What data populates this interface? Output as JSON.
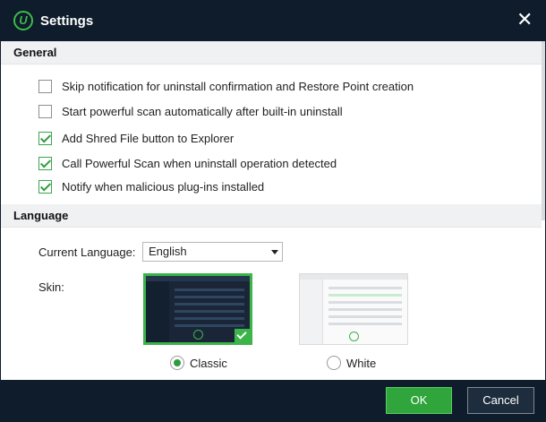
{
  "window": {
    "title": "Settings",
    "logo_glyph": "U"
  },
  "general": {
    "header": "General",
    "options": [
      {
        "label": "Skip notification for uninstall confirmation and Restore Point creation",
        "checked": false
      },
      {
        "label": "Start powerful scan automatically after built-in uninstall",
        "checked": false
      },
      {
        "label": "Add Shred File button to Explorer",
        "checked": true
      },
      {
        "label": "Call Powerful Scan when uninstall operation detected",
        "checked": true
      },
      {
        "label": "Notify when malicious plug-ins installed",
        "checked": true
      }
    ]
  },
  "language": {
    "header": "Language",
    "current_label": "Current Language:",
    "current_value": "English",
    "skin_label": "Skin:",
    "skins": [
      {
        "label": "Classic",
        "selected": true
      },
      {
        "label": "White",
        "selected": false
      }
    ]
  },
  "footer": {
    "ok_label": "OK",
    "cancel_label": "Cancel"
  },
  "colors": {
    "titlebar": "#0e1c2b",
    "accent": "#2fa53b",
    "check": "#2e9c3d"
  },
  "icons": {
    "logo": "app-logo-icon",
    "close": "close-icon",
    "dropdown": "chevron-down-icon",
    "selected": "checkmark-icon"
  }
}
